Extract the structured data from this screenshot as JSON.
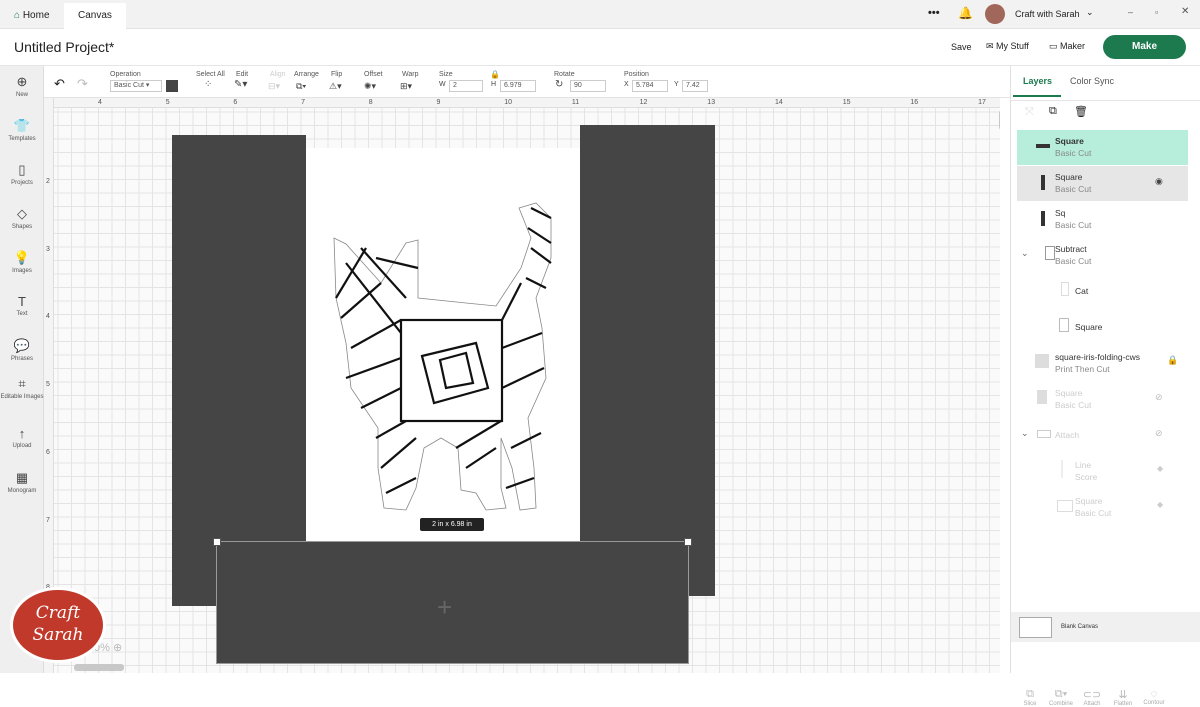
{
  "tabs": {
    "home": "Home",
    "canvas": "Canvas"
  },
  "account": {
    "name": "Craft with Sarah",
    "more": "•••"
  },
  "header": {
    "title": "Untitled Project*",
    "save": "Save",
    "my_stuff": "My Stuff",
    "maker": "Maker",
    "make": "Make"
  },
  "toolbar": {
    "operation_label": "Operation",
    "operation_value": "Basic Cut",
    "select_all": "Select All",
    "edit": "Edit",
    "align": "Align",
    "arrange": "Arrange",
    "flip": "Flip",
    "offset": "Offset",
    "warp": "Warp",
    "size": "Size",
    "w_label": "W",
    "w_value": "2",
    "h_label": "H",
    "h_value": "6.979",
    "rotate": "Rotate",
    "rotate_value": "90",
    "position": "Position",
    "x_label": "X",
    "x_value": "5.784",
    "y_label": "Y",
    "y_value": "7.42"
  },
  "sidebar": [
    {
      "label": "New",
      "icon": "⊕"
    },
    {
      "label": "Templates",
      "icon": "👕"
    },
    {
      "label": "Projects",
      "icon": "▯"
    },
    {
      "label": "Shapes",
      "icon": "◇"
    },
    {
      "label": "Images",
      "icon": "💡"
    },
    {
      "label": "Text",
      "icon": "T"
    },
    {
      "label": "Phrases",
      "icon": "💬"
    },
    {
      "label": "Editable Images",
      "icon": "⌗"
    },
    {
      "label": "Upload",
      "icon": "↑"
    },
    {
      "label": "Monogram",
      "icon": "▦"
    }
  ],
  "ruler_h": [
    "4",
    "5",
    "6",
    "7",
    "8",
    "9",
    "10",
    "11",
    "12",
    "13",
    "14",
    "15",
    "16",
    "17"
  ],
  "ruler_v": [
    "2",
    "3",
    "4",
    "5",
    "6",
    "7",
    "8"
  ],
  "canvas": {
    "size_label": "2  in x 6.98  in",
    "zoom": "0%",
    "logo": "Craft with Sarah"
  },
  "panel": {
    "tab_layers": "Layers",
    "tab_color_sync": "Color Sync",
    "layers": [
      {
        "name": "Square",
        "sub": "Basic Cut"
      },
      {
        "name": "Square",
        "sub": "Basic Cut"
      },
      {
        "name": "Sq",
        "sub": "Basic Cut"
      },
      {
        "name": "Subtract",
        "sub": "Basic Cut"
      },
      {
        "name": "Cat",
        "sub": ""
      },
      {
        "name": "Square",
        "sub": ""
      },
      {
        "name": "square-iris-folding-cws",
        "sub": "Print Then Cut"
      },
      {
        "name": "Square",
        "sub": "Basic Cut"
      },
      {
        "name": "Attach",
        "sub": ""
      },
      {
        "name": "Line",
        "sub": "Score"
      },
      {
        "name": "Square",
        "sub": "Basic Cut"
      }
    ],
    "blank_canvas": "Blank Canvas",
    "bottom": [
      "Slice",
      "Combine",
      "Attach",
      "Flatten",
      "Contour"
    ]
  },
  "colors": {
    "accent": "#1d7a4f",
    "selected": "#b6eedb",
    "shape": "#454545"
  }
}
